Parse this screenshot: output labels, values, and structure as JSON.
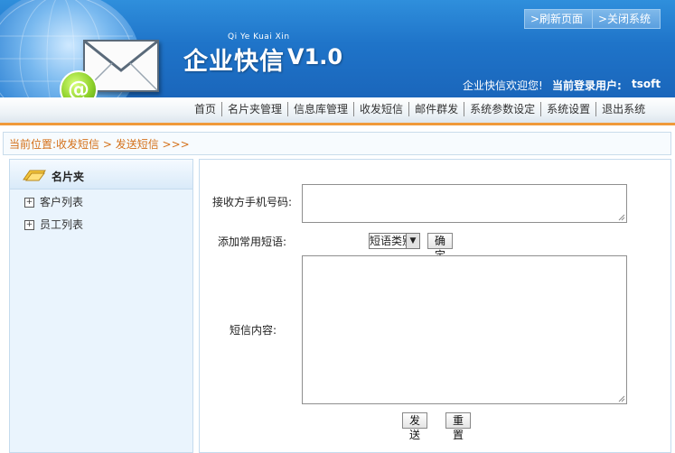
{
  "header": {
    "brand_pinyin": "Qi Ye Kuai Xin",
    "brand_title": "企业快信",
    "brand_version": "V1.0",
    "refresh_label": ">刷新页面",
    "close_label": ">关闭系统",
    "welcome": "企业快信欢迎您!",
    "login_label": "当前登录用户:",
    "login_user": "tsoft",
    "badge_symbol": "@"
  },
  "nav": {
    "items": [
      "首页",
      "名片夹管理",
      "信息库管理",
      "收发短信",
      "邮件群发",
      "系统参数设定",
      "系统设置",
      "退出系统"
    ]
  },
  "breadcrumb": "当前位置:收发短信 > 发送短信 >>>",
  "sidebar": {
    "title": "名片夹",
    "items": [
      {
        "label": "客户列表",
        "icon": "plus-box-icon"
      },
      {
        "label": "员工列表",
        "icon": "plus-box-icon"
      }
    ]
  },
  "form": {
    "phone_label": "接收方手机号码:",
    "phone_value": "",
    "phrase_label": "添加常用短语:",
    "phrase_select_value": "短语类别",
    "confirm_label": "确定",
    "content_label": "短信内容:",
    "content_value": "",
    "send_label": "发送",
    "reset_label": "重置"
  },
  "colors": {
    "header_blue": "#1f74c9",
    "accent_orange": "#f09a3a",
    "breadcrumb_text": "#d4711a",
    "sidebar_bg": "#eaf4fd"
  }
}
